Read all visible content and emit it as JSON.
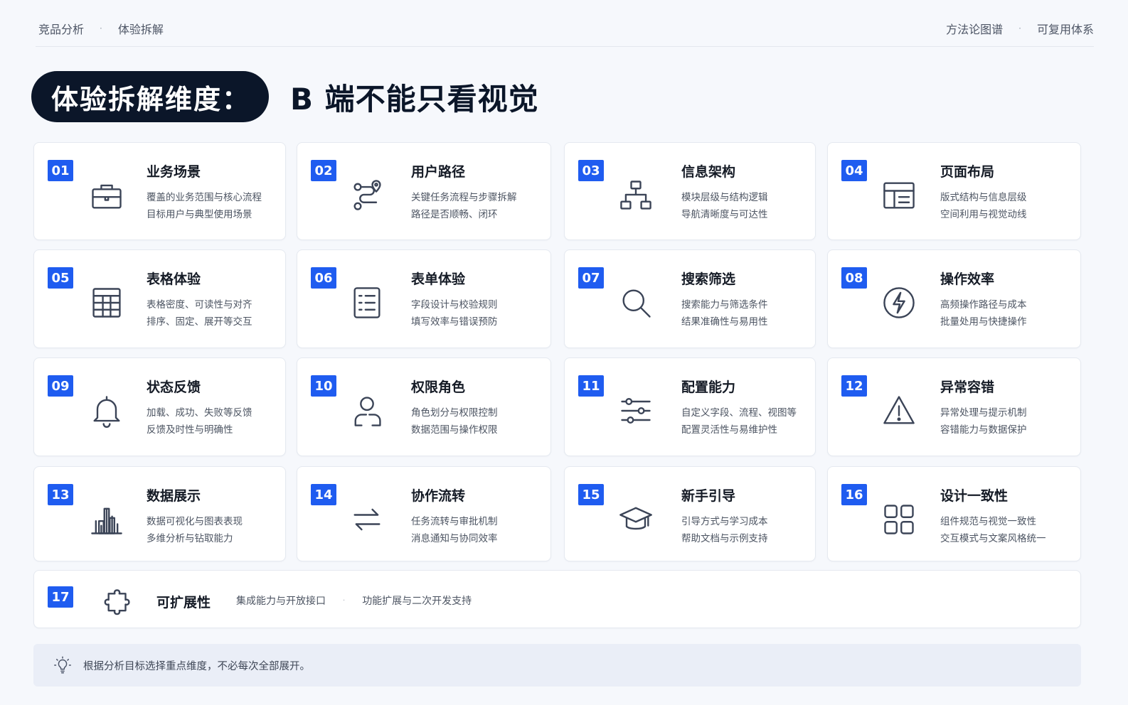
{
  "header": {
    "crumbs": [
      "竞品分析",
      "体验拆解"
    ],
    "tags": [
      "方法论图谱",
      "可复用体系"
    ],
    "separator": "·"
  },
  "title": {
    "pill": "体验拆解维度：",
    "subtitle": "B 端不能只看视觉"
  },
  "cards": [
    {
      "num": "01",
      "icon": "briefcase-icon",
      "title": "业务场景",
      "line1": "覆盖的业务范围与核心流程",
      "line2": "目标用户与典型使用场景"
    },
    {
      "num": "02",
      "icon": "route-icon",
      "title": "用户路径",
      "line1": "关键任务流程与步骤拆解",
      "line2": "路径是否顺畅、闭环"
    },
    {
      "num": "03",
      "icon": "sitemap-icon",
      "title": "信息架构",
      "line1": "模块层级与结构逻辑",
      "line2": "导航清晰度与可达性"
    },
    {
      "num": "04",
      "icon": "layout-icon",
      "title": "页面布局",
      "line1": "版式结构与信息层级",
      "line2": "空间利用与视觉动线"
    },
    {
      "num": "05",
      "icon": "table-icon",
      "title": "表格体验",
      "line1": "表格密度、可读性与对齐",
      "line2": "排序、固定、展开等交互"
    },
    {
      "num": "06",
      "icon": "form-icon",
      "title": "表单体验",
      "line1": "字段设计与校验规则",
      "line2": "填写效率与错误预防"
    },
    {
      "num": "07",
      "icon": "search-icon",
      "title": "搜索筛选",
      "line1": "搜索能力与筛选条件",
      "line2": "结果准确性与易用性"
    },
    {
      "num": "08",
      "icon": "lightning-icon",
      "title": "操作效率",
      "line1": "高频操作路径与成本",
      "line2": "批量处用与快捷操作"
    },
    {
      "num": "09",
      "icon": "bell-icon",
      "title": "状态反馈",
      "line1": "加载、成功、失败等反馈",
      "line2": "反馈及时性与明确性"
    },
    {
      "num": "10",
      "icon": "user-icon",
      "title": "权限角色",
      "line1": "角色划分与权限控制",
      "line2": "数据范围与操作权限"
    },
    {
      "num": "11",
      "icon": "sliders-icon",
      "title": "配置能力",
      "line1": "自定义字段、流程、视图等",
      "line2": "配置灵活性与易维护性"
    },
    {
      "num": "12",
      "icon": "warning-icon",
      "title": "异常容错",
      "line1": "异常处理与提示机制",
      "line2": "容错能力与数据保护"
    },
    {
      "num": "13",
      "icon": "bar-chart-icon",
      "title": "数据展示",
      "line1": "数据可视化与图表表现",
      "line2": "多维分析与钻取能力"
    },
    {
      "num": "14",
      "icon": "swap-icon",
      "title": "协作流转",
      "line1": "任务流转与审批机制",
      "line2": "消息通知与协同效率"
    },
    {
      "num": "15",
      "icon": "graduation-cap-icon",
      "title": "新手引导",
      "line1": "引导方式与学习成本",
      "line2": "帮助文档与示例支持"
    },
    {
      "num": "16",
      "icon": "grid-icon",
      "title": "设计一致性",
      "line1": "组件规范与视觉一致性",
      "line2": "交互模式与文案风格统一"
    }
  ],
  "wide_card": {
    "num": "17",
    "icon": "puzzle-icon",
    "title": "可扩展性",
    "desc1": "集成能力与开放接口",
    "desc2": "功能扩展与二次开发支持",
    "separator": "·"
  },
  "tip": {
    "icon": "lightbulb-icon",
    "text": "根据分析目标选择重点维度，不必每次全部展开。"
  },
  "colors": {
    "accent": "#1f5cf0",
    "dark": "#0b1629",
    "icon_stroke": "#3b4457",
    "background": "#f6f8fc"
  }
}
